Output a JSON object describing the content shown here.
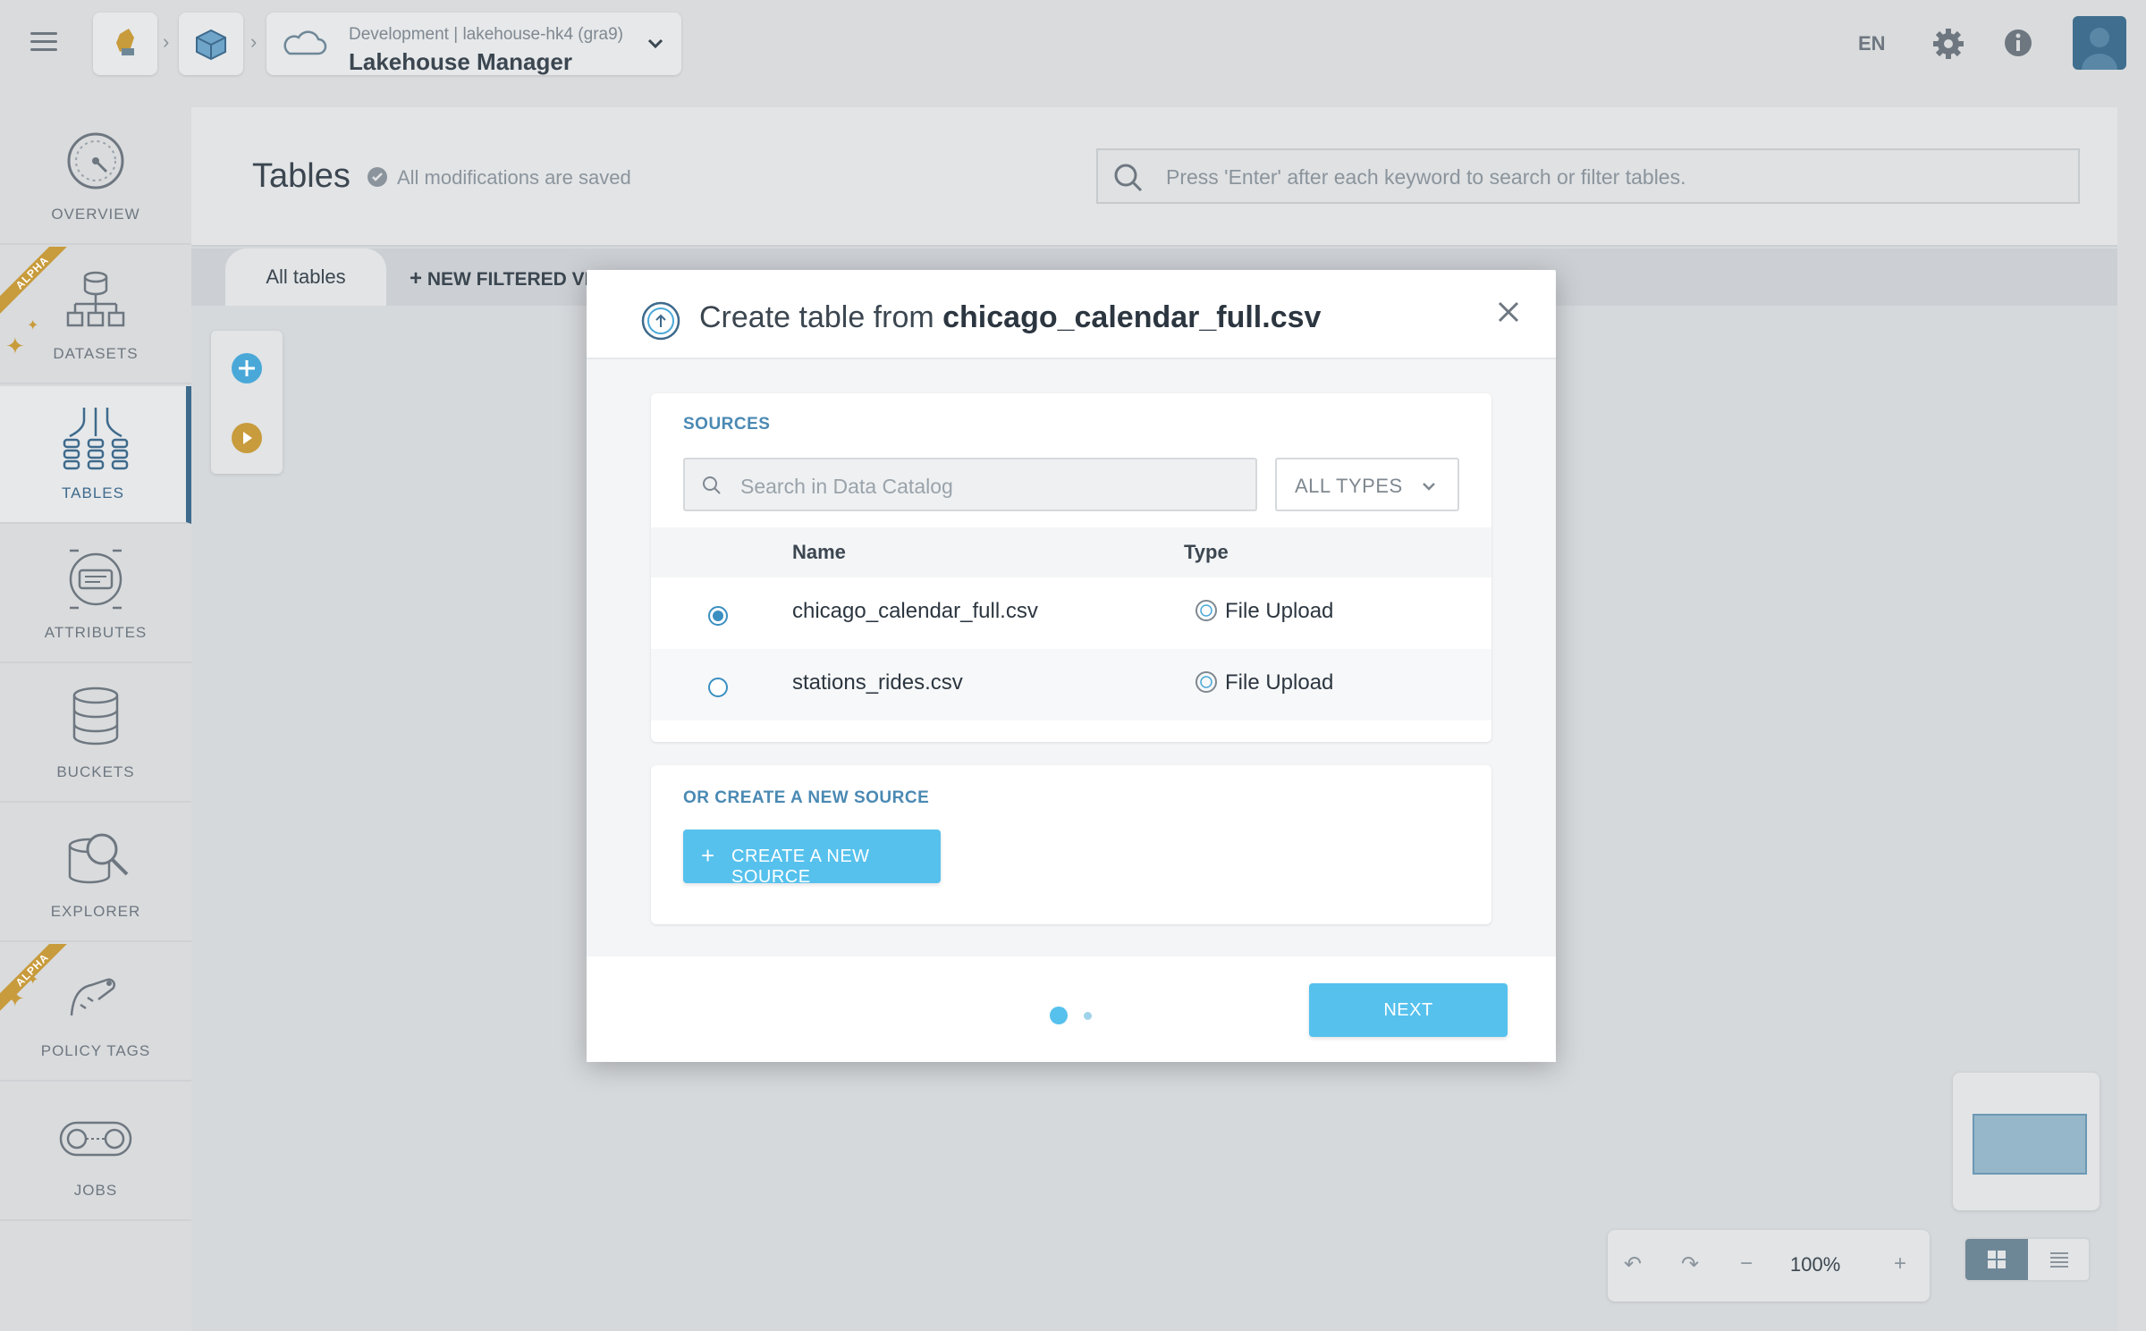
{
  "topbar": {
    "project_env": "Development  |  lakehouse-hk4 (gra9)",
    "app_name": "Lakehouse Manager",
    "language": "EN"
  },
  "sidebar": {
    "items": [
      {
        "label": "OVERVIEW",
        "icon": "gauge-icon"
      },
      {
        "label": "DATASETS",
        "icon": "datasets-icon",
        "badge": "ALPHA"
      },
      {
        "label": "TABLES",
        "icon": "tables-icon",
        "active": true
      },
      {
        "label": "ATTRIBUTES",
        "icon": "attributes-icon"
      },
      {
        "label": "BUCKETS",
        "icon": "database-icon"
      },
      {
        "label": "EXPLORER",
        "icon": "explorer-icon"
      },
      {
        "label": "POLICY TAGS",
        "icon": "tag-icon",
        "badge": "ALPHA"
      },
      {
        "label": "JOBS",
        "icon": "jobs-icon"
      }
    ]
  },
  "main": {
    "title": "Tables",
    "saved_status": "All modifications are saved",
    "search_placeholder": "Press 'Enter' after each keyword to search or filter tables.",
    "tabs": {
      "all": "All tables",
      "new_filtered": "NEW FILTERED VI"
    },
    "zoom": "100%"
  },
  "modal": {
    "title_prefix": "Create table from ",
    "title_file": "chicago_calendar_full.csv",
    "sources_label": "SOURCES",
    "search_placeholder": "Search in Data Catalog",
    "type_filter": "ALL TYPES",
    "columns": {
      "name": "Name",
      "type": "Type"
    },
    "rows": [
      {
        "name": "chicago_calendar_full.csv",
        "type": "File Upload",
        "selected": true
      },
      {
        "name": "stations_rides.csv",
        "type": "File Upload",
        "selected": false
      }
    ],
    "create_label": "OR CREATE A NEW SOURCE",
    "create_button": "CREATE A NEW SOURCE",
    "next_button": "NEXT"
  },
  "colors": {
    "accent": "#56c1ed",
    "brand_dark": "#3e6a8c",
    "alpha_badge": "#c89b3c"
  }
}
